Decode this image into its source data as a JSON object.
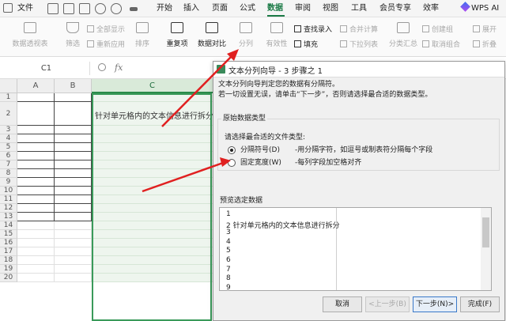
{
  "menubar": {
    "file_label": "文件",
    "tabs": [
      "开始",
      "插入",
      "页面",
      "公式",
      "数据",
      "审阅",
      "视图",
      "工具",
      "会员专享",
      "效率",
      "WPS AI"
    ]
  },
  "ribbon": {
    "pivot": "数据透视表",
    "filter": "筛选",
    "show_all": "全部显示",
    "reapply": "重新应用",
    "sort": "排序",
    "duplicates": "重复项",
    "compare": "数据对比",
    "text_to_columns": "分列",
    "validity": "有效性",
    "find_entry": "查找录入",
    "fill": "填充",
    "merge_calc": "合并计算",
    "dropdown_list": "下拉列表",
    "subtotal": "分类汇总",
    "create_group": "创建组",
    "ungroup": "取消组合",
    "expand": "展开",
    "collapse": "折叠"
  },
  "formula": {
    "name_box": "C1",
    "fx": "fx"
  },
  "sheet": {
    "columns": [
      "A",
      "B",
      "C"
    ],
    "rows": [
      "1",
      "2",
      "3",
      "4",
      "5",
      "6",
      "7",
      "8",
      "9",
      "10",
      "11",
      "12",
      "13",
      "14",
      "15",
      "16",
      "17",
      "18",
      "19",
      "20"
    ],
    "cell_c2": "针对单元格内的文本信息进行拆分"
  },
  "dialog": {
    "title": "文本分列向导 - 3 步骤之 1",
    "intro_line1": "文本分列向导判定您的数据有分隔符。",
    "intro_line2": "若一切设置无误，请单击“下一步”，否则请选择最合适的数据类型。",
    "group_title": "原始数据类型",
    "prompt": "请选择最合适的文件类型:",
    "option_delimited": "分隔符号(D)",
    "option_delimited_desc": "-用分隔字符，如逗号或制表符分隔每个字段",
    "option_fixed": "固定宽度(W)",
    "option_fixed_desc": "-每列字段加空格对齐",
    "preview_title": "预览选定数据",
    "preview_lines": [
      "1",
      "2  针对单元格内的文本信息进行拆分",
      "3",
      "4",
      "5",
      "6",
      "7",
      "8",
      "9"
    ],
    "buttons": {
      "cancel": "取消",
      "back": "<上一步(B)",
      "next": "下一步(N)>",
      "finish": "完成(F)"
    }
  },
  "colors": {
    "accent": "#1a7a45",
    "arrow": "#e02020"
  }
}
